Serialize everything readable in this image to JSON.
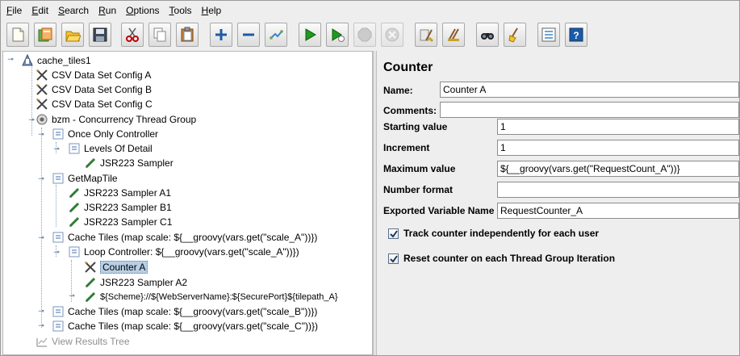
{
  "menu": [
    {
      "u": "F",
      "rest": "ile"
    },
    {
      "u": "E",
      "rest": "dit"
    },
    {
      "u": "S",
      "rest": "earch"
    },
    {
      "u": "R",
      "rest": "un"
    },
    {
      "u": "O",
      "rest": "ptions"
    },
    {
      "u": "T",
      "rest": "ools"
    },
    {
      "u": "H",
      "rest": "elp"
    }
  ],
  "toolbar": {
    "buttons": [
      "new-icon",
      "templates-icon",
      "open-icon",
      "save-icon",
      "cut-icon",
      "copy-icon",
      "paste-icon",
      "expand-icon",
      "collapse-icon",
      "toggle-icon",
      "start-icon",
      "start-no-pauses-icon",
      "stop-icon",
      "shutdown-icon",
      "clear-icon",
      "clear-all-icon",
      "search-icon",
      "reset-search-icon",
      "function-helper-icon",
      "help-icon"
    ]
  },
  "tree": [
    {
      "label": "cache_tiles1",
      "icon": "test-plan-icon"
    },
    {
      "label": "CSV Data Set Config A",
      "icon": "config-element-icon"
    },
    {
      "label": "CSV Data Set Config B",
      "icon": "config-element-icon"
    },
    {
      "label": "CSV Data Set Config C",
      "icon": "config-element-icon"
    },
    {
      "label": "bzm - Concurrency Thread Group",
      "icon": "thread-group-icon"
    },
    {
      "label": "Once Only Controller",
      "icon": "controller-icon"
    },
    {
      "label": "Levels Of Detail",
      "icon": "controller-icon"
    },
    {
      "label": "JSR223 Sampler",
      "icon": "sampler-icon"
    },
    {
      "label": "GetMapTile",
      "icon": "controller-icon"
    },
    {
      "label": "JSR223 Sampler A1",
      "icon": "sampler-icon"
    },
    {
      "label": "JSR223 Sampler B1",
      "icon": "sampler-icon"
    },
    {
      "label": "JSR223 Sampler C1",
      "icon": "sampler-icon"
    },
    {
      "label": "Cache Tiles (map scale: ${__groovy(vars.get(\"scale_A\"))})",
      "icon": "controller-icon"
    },
    {
      "label": "Loop Controller: ${__groovy(vars.get(\"scale_A\"))})",
      "icon": "controller-icon"
    },
    {
      "label": "Counter A",
      "icon": "config-element-icon"
    },
    {
      "label": "JSR223 Sampler A2",
      "icon": "sampler-icon"
    },
    {
      "label": "${Scheme}://${WebServerName}:${SecurePort}${tilepath_A}",
      "icon": "sampler-icon"
    },
    {
      "label": "Cache Tiles (map scale: ${__groovy(vars.get(\"scale_B\"))})",
      "icon": "controller-icon"
    },
    {
      "label": "Cache Tiles (map scale: ${__groovy(vars.get(\"scale_C\"))})",
      "icon": "controller-icon"
    },
    {
      "label": "View Results Tree",
      "icon": "listener-icon"
    }
  ],
  "panel": {
    "title": "Counter",
    "name_label": "Name:",
    "name_value": "Counter A",
    "comments_label": "Comments:",
    "comments_value": "",
    "start_label": "Starting value",
    "start_value": "1",
    "increment_label": "Increment",
    "increment_value": "1",
    "max_label": "Maximum value",
    "max_value": "${__groovy(vars.get(\"RequestCount_A\"))}",
    "format_label": "Number format",
    "format_value": "",
    "export_label": "Exported Variable Name",
    "export_value": "RequestCounter_A",
    "track_label": "Track counter independently for each user",
    "track_checked": true,
    "reset_label": "Reset counter on each Thread Group Iteration",
    "reset_checked": true
  },
  "colors": {
    "selection": "#b8cfe5",
    "panel_bg": "#eeeeee",
    "start_green": "#1e9a1e",
    "help_blue": "#1d5aa8"
  }
}
